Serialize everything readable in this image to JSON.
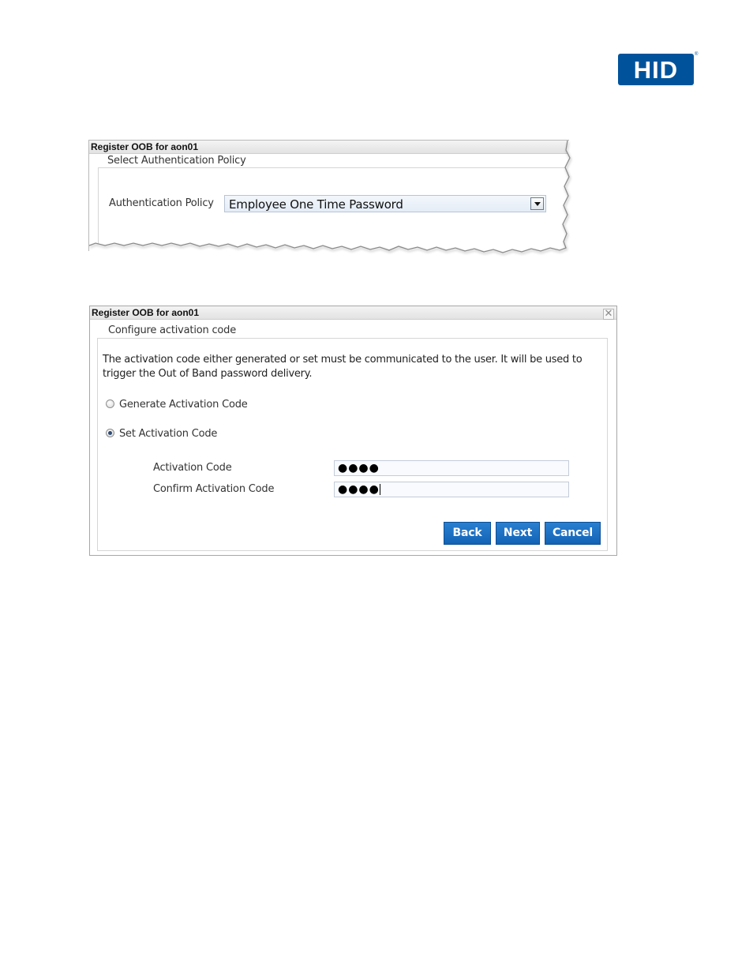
{
  "logo": {
    "text": "HID",
    "registered": "®"
  },
  "panel1": {
    "title": "Register OOB for aon01",
    "legend": "Select Authentication Policy",
    "policy_label": "Authentication Policy",
    "policy_value": "Employee One Time Password"
  },
  "panel2": {
    "title": "Register OOB for aon01",
    "close_glyph": "✕",
    "legend": "Configure activation code",
    "description": "The activation code either generated or set must be communicated to the user. It will be used to trigger the Out of Band password delivery.",
    "radio_generate": "Generate Activation Code",
    "radio_set": "Set Activation Code",
    "selected_option": "Set Activation Code",
    "activation_code_label": "Activation Code",
    "activation_code_value": "●●●●",
    "confirm_label": "Confirm Activation Code",
    "confirm_value": "●●●●",
    "buttons": {
      "back": "Back",
      "next": "Next",
      "cancel": "Cancel"
    }
  },
  "colors": {
    "logo_blue": "#00539b",
    "button_blue": "#1a6fc4"
  }
}
